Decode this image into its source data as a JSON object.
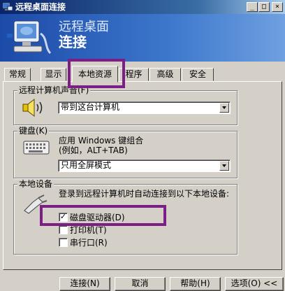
{
  "window": {
    "title": "远程桌面连接",
    "min": "_",
    "max": "□",
    "close": "×"
  },
  "banner": {
    "line1": "远程桌面",
    "line2": "连接"
  },
  "tabs": [
    "常规",
    "显示",
    "本地资源",
    "程序",
    "高级",
    "安全"
  ],
  "sound": {
    "label": "远程计算机声音(F)",
    "selected": "带到这台计算机"
  },
  "keyboard": {
    "label": "键盘(K)",
    "description_line1": "应用 Windows 键组合",
    "description_line2": "(例如，ALT+TAB)",
    "selected": "只用全屏模式"
  },
  "devices": {
    "label": "本地设备",
    "description": "登录到远程计算机时自动连接到以下本地设备:",
    "items": [
      {
        "label": "磁盘驱动器(D)",
        "checked": "✓"
      },
      {
        "label": "打印机(T)",
        "checked": ""
      },
      {
        "label": "串行口(R)",
        "checked": ""
      }
    ]
  },
  "buttons": {
    "connect": "连接(N)",
    "cancel": "取消",
    "help": "帮助(H)",
    "options": "选项(O) <<"
  },
  "colors": {
    "title_bar": "#0a246a",
    "banner": "#3d78cc",
    "highlight": "#7b1f86"
  }
}
